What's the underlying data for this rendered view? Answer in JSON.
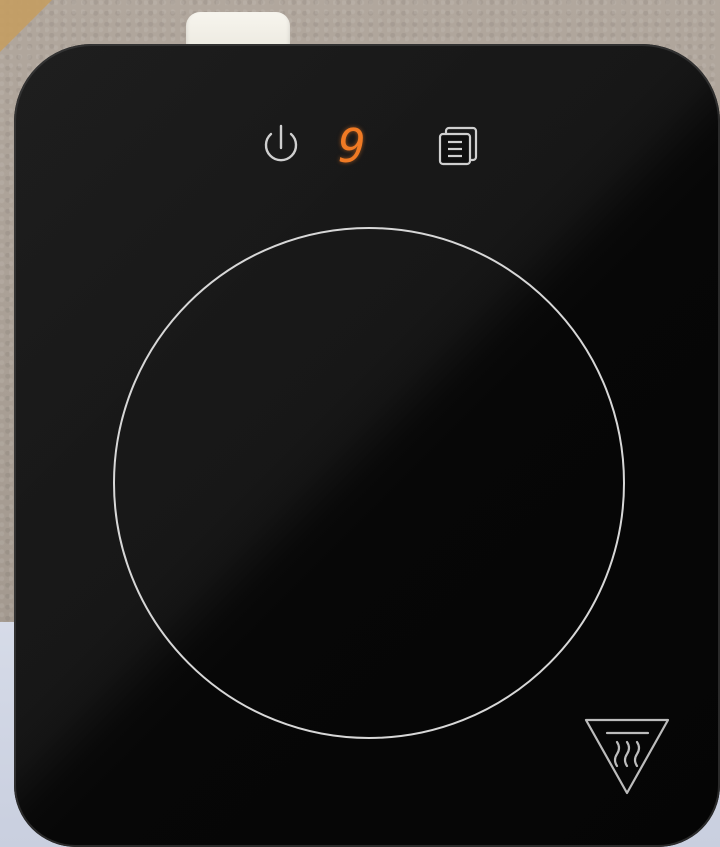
{
  "cooktop": {
    "display": {
      "power_level": "9"
    },
    "controls": [
      {
        "id": "power",
        "icon": "power-icon"
      },
      {
        "id": "menu",
        "icon": "menu-icon"
      }
    ],
    "warning_icon": "hot-surface-warning-icon",
    "colors": {
      "glass": "#0b0b0b",
      "display": "#f07a24",
      "ring": "#d9d9d9",
      "wall": "#a79d93",
      "table": "#d0d6e4"
    }
  }
}
